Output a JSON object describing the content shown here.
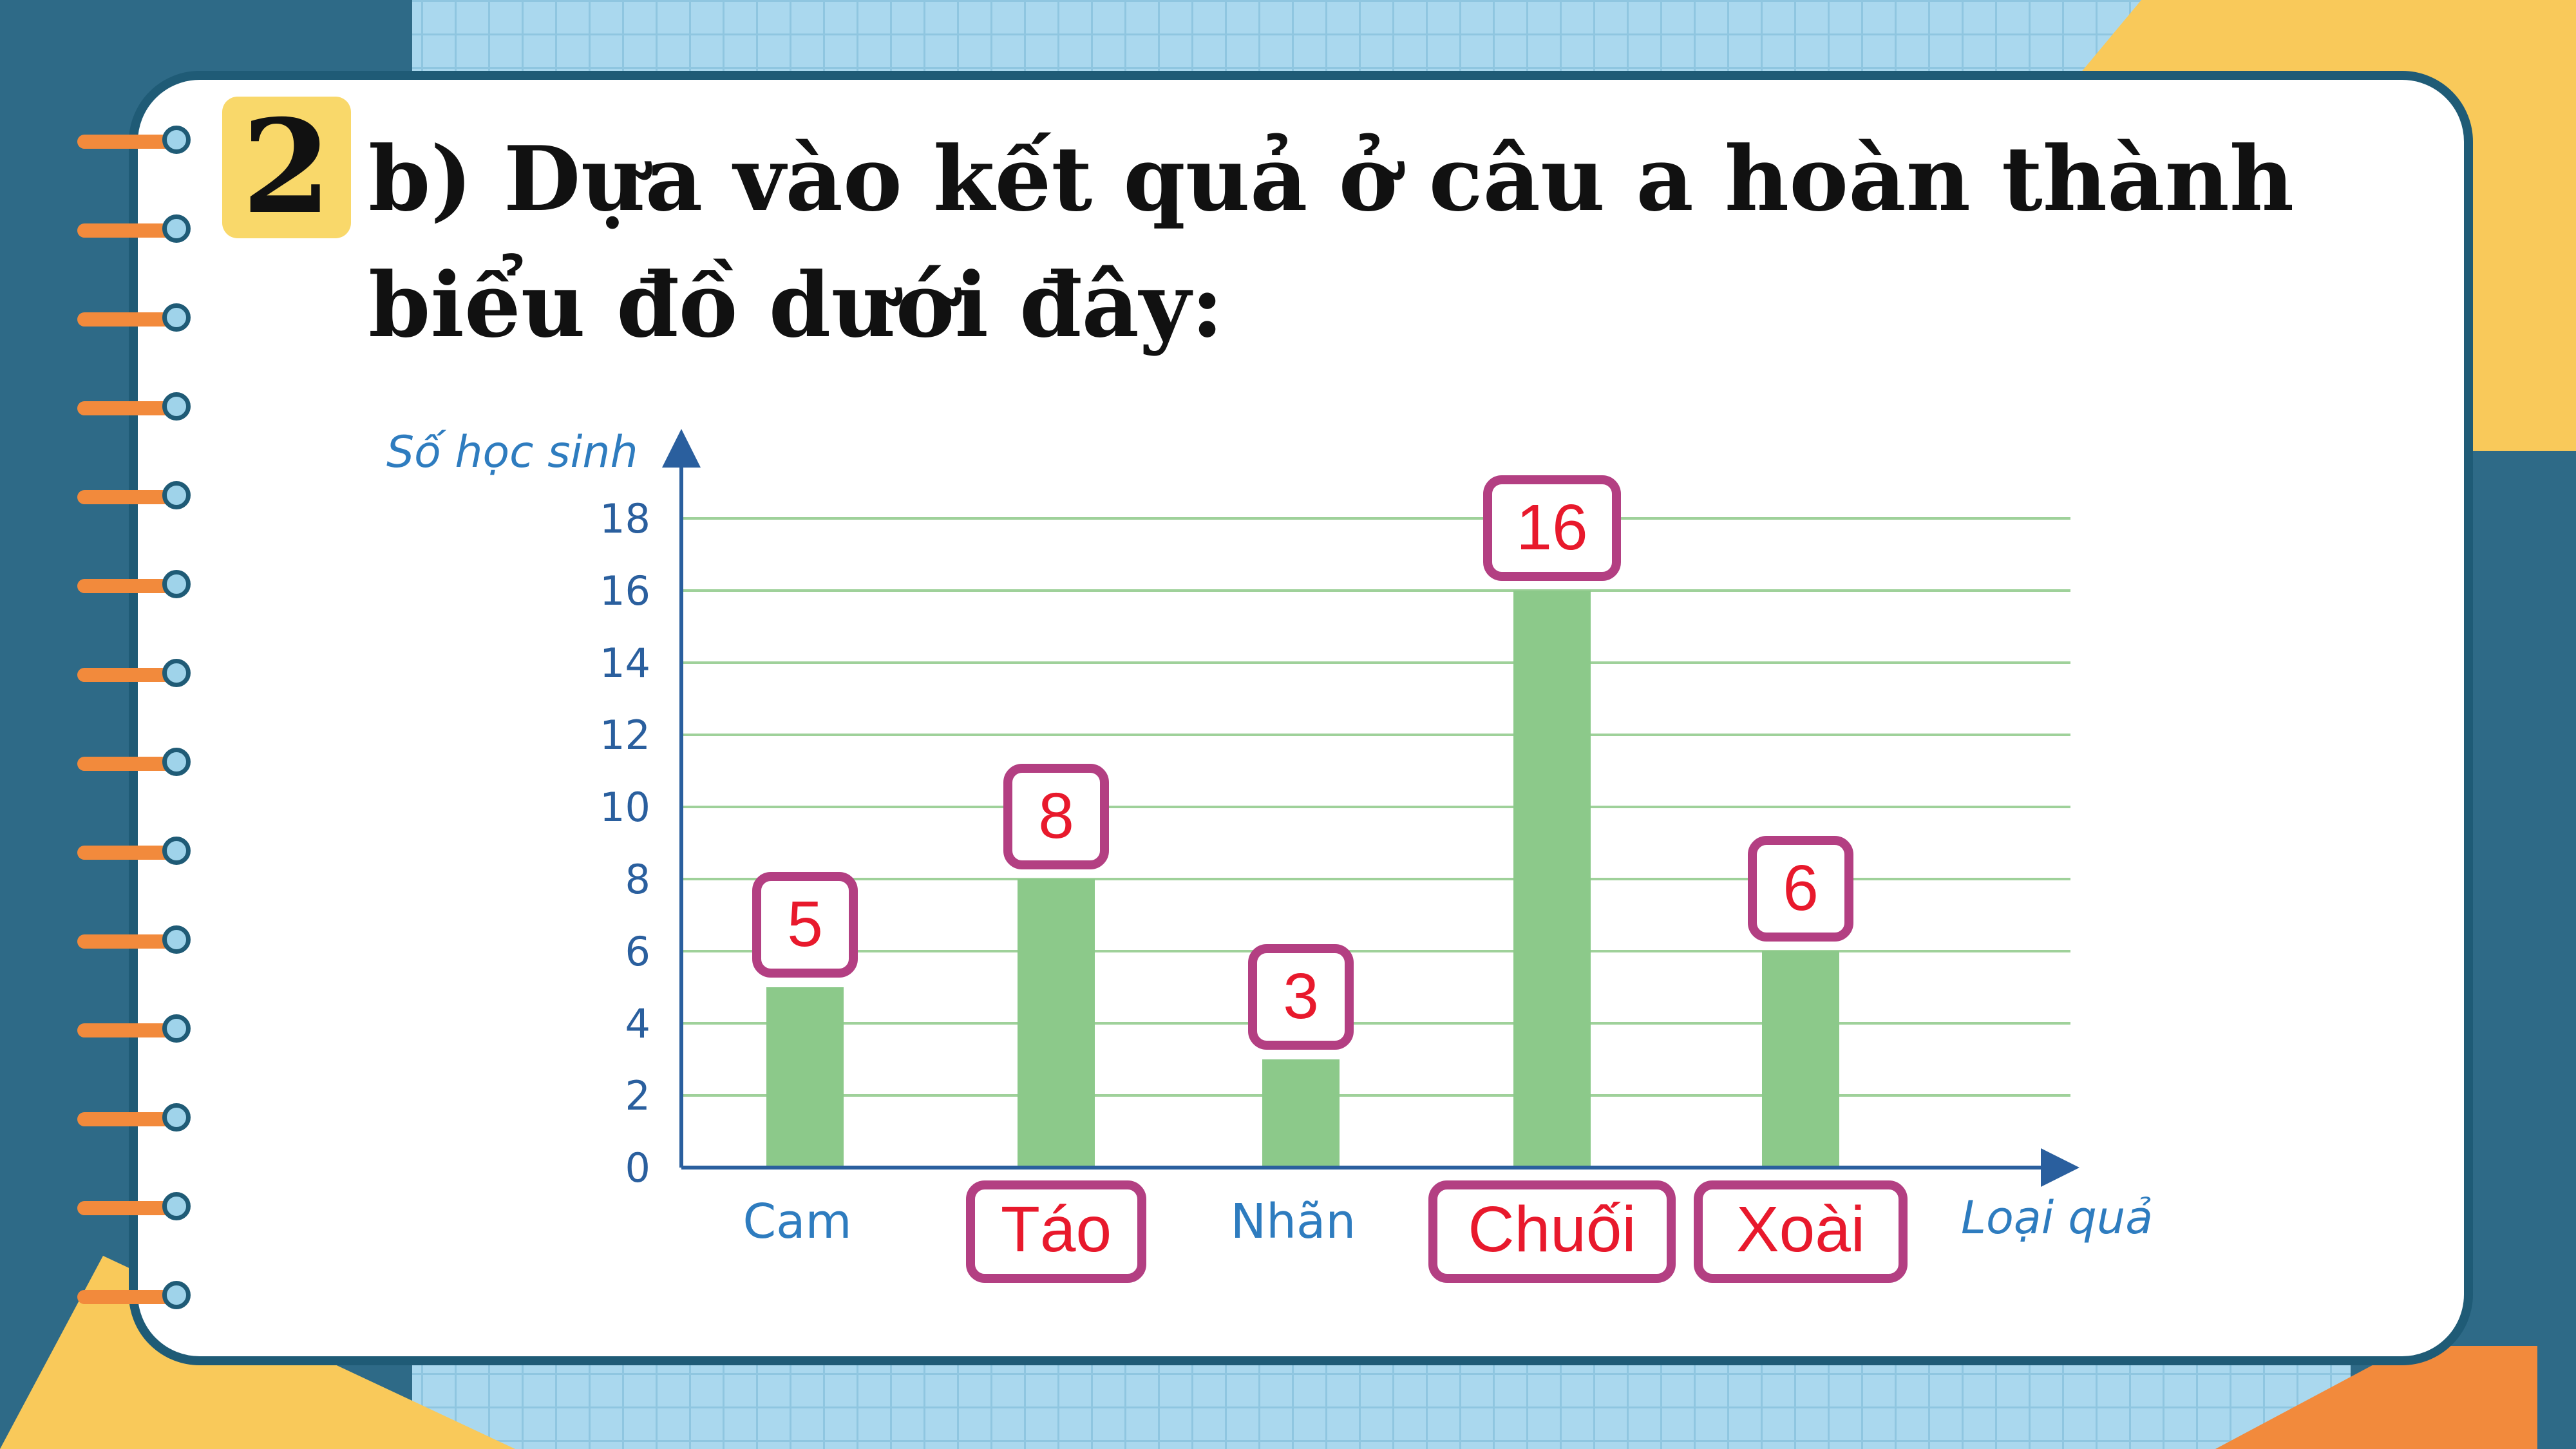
{
  "question": {
    "number": "2",
    "text": "b) Dựa vào kết quả ở câu a hoàn thành biểu đồ dưới đây:"
  },
  "colors": {
    "bar": "#8cc98a",
    "grid": "#9fd19a",
    "axis": "#2a5f9e",
    "answer_text": "#e8192c",
    "answer_box": "#b33f82",
    "axis_text": "#2e7cbf"
  },
  "chart_data": {
    "type": "bar",
    "ylabel": "Số học sinh",
    "xlabel": "Loại quả",
    "categories": [
      "Cam",
      "Táo",
      "Nhãn",
      "Chuối",
      "Xoài"
    ],
    "category_filled_in": [
      false,
      true,
      false,
      true,
      true
    ],
    "values": [
      5,
      8,
      3,
      16,
      6
    ],
    "yticks": [
      "0",
      "2",
      "4",
      "6",
      "8",
      "10",
      "12",
      "14",
      "16",
      "18"
    ],
    "ylim": [
      0,
      18
    ],
    "grid": true,
    "value_labels": [
      "5",
      "8",
      "3",
      "16",
      "6"
    ]
  }
}
